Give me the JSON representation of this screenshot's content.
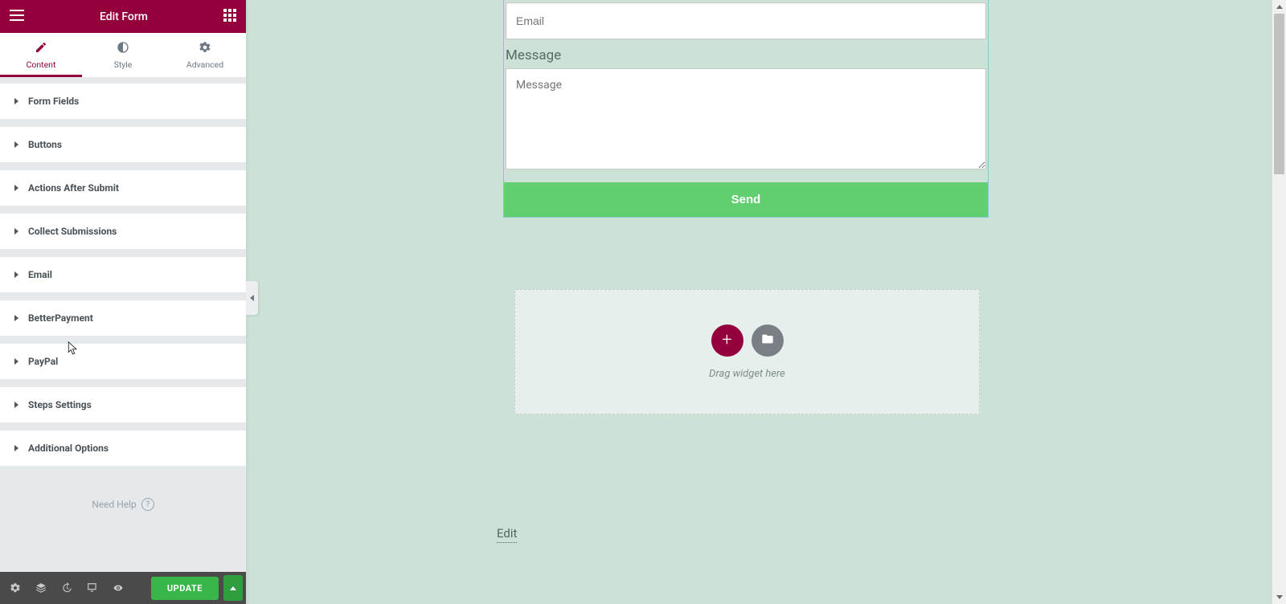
{
  "sidebar": {
    "title": "Edit Form",
    "tabs": [
      {
        "label": "Content",
        "icon": "pencil-icon"
      },
      {
        "label": "Style",
        "icon": "contrast-icon"
      },
      {
        "label": "Advanced",
        "icon": "gear-icon"
      }
    ],
    "sections": [
      "Form Fields",
      "Buttons",
      "Actions After Submit",
      "Collect Submissions",
      "Email",
      "BetterPayment",
      "PayPal",
      "Steps Settings",
      "Additional Options"
    ],
    "need_help": "Need Help",
    "update_label": "UPDATE"
  },
  "canvas": {
    "form": {
      "email_placeholder": "Email",
      "message_label": "Message",
      "message_placeholder": "Message",
      "send_label": "Send"
    },
    "drop_zone": {
      "hint": "Drag widget here"
    },
    "edit_link": "Edit"
  }
}
